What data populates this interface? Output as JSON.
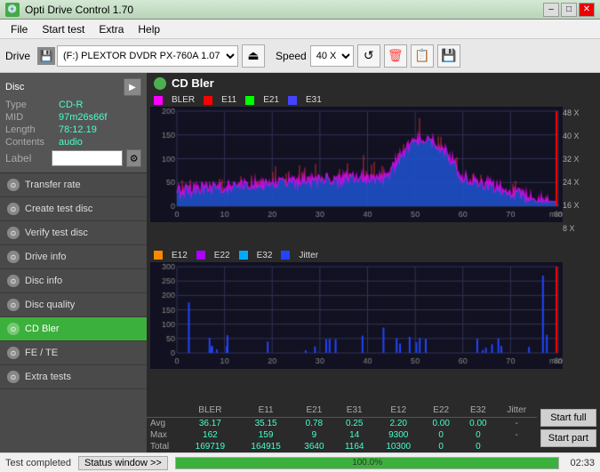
{
  "titlebar": {
    "title": "Opti Drive Control 1.70",
    "minimize": "–",
    "maximize": "□",
    "close": "✕"
  },
  "menubar": {
    "items": [
      "File",
      "Start test",
      "Extra",
      "Help"
    ]
  },
  "toolbar": {
    "drive_label": "Drive",
    "drive_value": "(F:)  PLEXTOR DVDR  PX-760A 1.07",
    "speed_label": "Speed",
    "speed_value": "40 X"
  },
  "disc": {
    "header": "Disc",
    "type_label": "Type",
    "type_value": "CD-R",
    "mid_label": "MID",
    "mid_value": "97m26s66f",
    "length_label": "Length",
    "length_value": "78:12.19",
    "contents_label": "Contents",
    "contents_value": "audio",
    "label_label": "Label",
    "label_value": ""
  },
  "nav": {
    "items": [
      {
        "id": "transfer-rate",
        "label": "Transfer rate",
        "active": false
      },
      {
        "id": "create-test-disc",
        "label": "Create test disc",
        "active": false
      },
      {
        "id": "verify-test-disc",
        "label": "Verify test disc",
        "active": false
      },
      {
        "id": "drive-info",
        "label": "Drive info",
        "active": false
      },
      {
        "id": "disc-info",
        "label": "Disc info",
        "active": false
      },
      {
        "id": "disc-quality",
        "label": "Disc quality",
        "active": false
      },
      {
        "id": "cd-bler",
        "label": "CD Bler",
        "active": true
      },
      {
        "id": "fe-te",
        "label": "FE / TE",
        "active": false
      },
      {
        "id": "extra-tests",
        "label": "Extra tests",
        "active": false
      }
    ]
  },
  "chart": {
    "title": "CD Bler",
    "top_legend": [
      {
        "label": "BLER",
        "color": "#ff00ff"
      },
      {
        "label": "E11",
        "color": "#ff0000"
      },
      {
        "label": "E21",
        "color": "#00ff00"
      },
      {
        "label": "E31",
        "color": "#0000ff"
      }
    ],
    "bottom_legend": [
      {
        "label": "E12",
        "color": "#ff8800"
      },
      {
        "label": "E22",
        "color": "#aa00ff"
      },
      {
        "label": "E32",
        "color": "#00aaff"
      },
      {
        "label": "Jitter",
        "color": "#0000ff"
      }
    ],
    "top_y": [
      "200",
      "150",
      "100",
      "50",
      "0"
    ],
    "bottom_y": [
      "300",
      "250",
      "200",
      "150",
      "100",
      "50",
      "0"
    ],
    "x_labels": [
      "0",
      "10",
      "20",
      "30",
      "40",
      "50",
      "60",
      "70",
      "80"
    ],
    "top_right_labels": [
      "48 X",
      "40 X",
      "32 X",
      "24 X",
      "16 X",
      "8 X"
    ],
    "min_label": "min"
  },
  "stats": {
    "columns": [
      "",
      "BLER",
      "E11",
      "E21",
      "E31",
      "E12",
      "E22",
      "E32",
      "Jitter"
    ],
    "rows": [
      {
        "label": "Avg",
        "values": [
          "36.17",
          "35.15",
          "0.78",
          "0.25",
          "2.20",
          "0.00",
          "0.00",
          "-"
        ]
      },
      {
        "label": "Max",
        "values": [
          "162",
          "159",
          "9",
          "14",
          "9300",
          "0",
          "0",
          "-"
        ]
      },
      {
        "label": "Total",
        "values": [
          "169719",
          "164915",
          "3640",
          "1164",
          "10300",
          "0",
          "0",
          ""
        ]
      }
    ]
  },
  "buttons": {
    "start_full": "Start full",
    "start_part": "Start part"
  },
  "statusbar": {
    "status_button": "Status window >>",
    "progress_pct": 100.0,
    "progress_text": "100.0%",
    "time": "02:33",
    "message": "Test completed"
  }
}
